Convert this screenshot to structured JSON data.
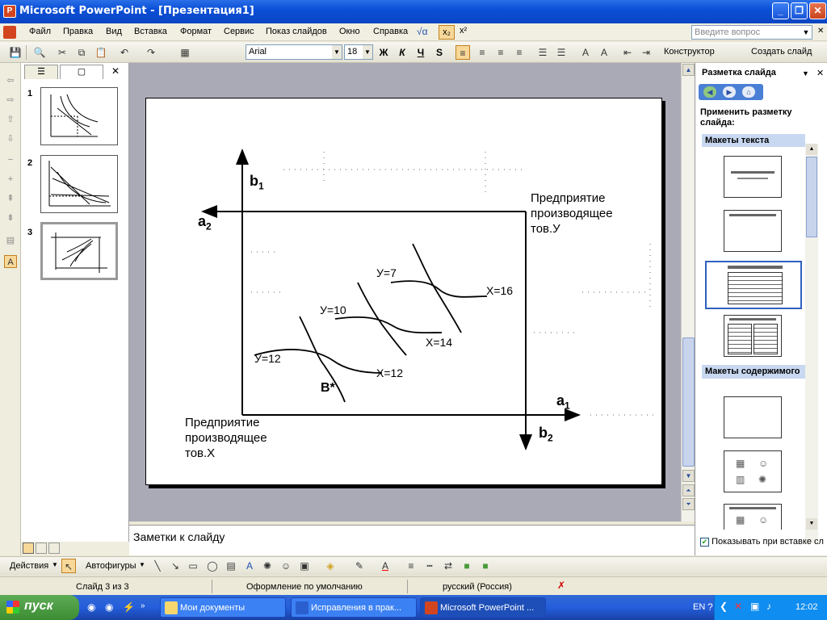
{
  "window": {
    "title": "Microsoft PowerPoint - [Презентация1]",
    "app_icon": "powerpoint-icon",
    "controls": [
      "_",
      "❐",
      "✕"
    ]
  },
  "menu": {
    "items": [
      "Файл",
      "Правка",
      "Вид",
      "Вставка",
      "Формат",
      "Сервис",
      "Показ слайдов",
      "Окно",
      "Справка"
    ],
    "help_placeholder": "Введите вопрос",
    "subscript": "x₂",
    "superscript": "x²"
  },
  "toolbar": {
    "font": "Arial",
    "size": "18",
    "bold": "Ж",
    "italic": "К",
    "underline": "Ч",
    "shadow": "S",
    "designer": "Конструктор",
    "new_slide": "Создать слайд"
  },
  "slides_pane": {
    "numbers": [
      "1",
      "2",
      "3"
    ],
    "selected": 3
  },
  "slide": {
    "labels": {
      "b1": "b",
      "b1_sub": "1",
      "a2": "a",
      "a2_sub": "2",
      "a1": "a",
      "a1_sub": "1",
      "b2": "b",
      "b2_sub": "2",
      "enterprise_y": [
        "Предприятие",
        "производящее",
        "тов.У"
      ],
      "enterprise_x": [
        "Предприятие",
        "производящее",
        "тов.Х"
      ],
      "y7": "У=7",
      "y10": "У=10",
      "y12": "У=12",
      "x16": "Х=16",
      "x14": "Х=14",
      "x12": "Х=12",
      "b_star": "В*"
    }
  },
  "notes": {
    "placeholder": "Заметки к слайду"
  },
  "task_pane": {
    "title": "Разметка слайда",
    "apply_label": "Применить разметку слайда:",
    "section_text": "Макеты текста",
    "section_content": "Макеты содержимого",
    "show_on_insert": "Показывать при вставке сл"
  },
  "drawing_toolbar": {
    "actions": "Действия",
    "autoshapes": "Автофигуры"
  },
  "statusbar": {
    "slide": "Слайд 3 из 3",
    "design": "Оформление по умолчанию",
    "language": "русский (Россия)"
  },
  "taskbar": {
    "start": "пуск",
    "tasks": [
      "Мои документы",
      "Исправления в прак...",
      "Microsoft PowerPoint ..."
    ],
    "lang": "EN",
    "time": "12:02"
  }
}
